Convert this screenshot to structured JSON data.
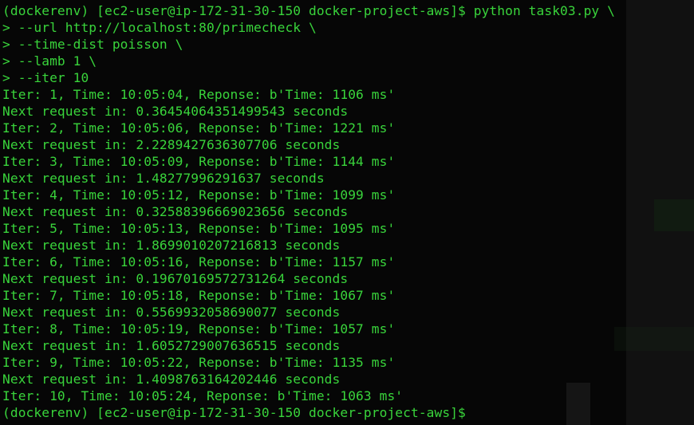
{
  "terminal": {
    "lines": [
      "(dockerenv) [ec2-user@ip-172-31-30-150 docker-project-aws]$ python task03.py \\",
      "> --url http://localhost:80/primecheck \\",
      "> --time-dist poisson \\",
      "> --lamb 1 \\",
      "> --iter 10",
      "Iter: 1, Time: 10:05:04, Reponse: b'Time: 1106 ms'",
      "Next request in: 0.36454064351499543 seconds",
      "Iter: 2, Time: 10:05:06, Reponse: b'Time: 1221 ms'",
      "Next request in: 2.2289427636307706 seconds",
      "Iter: 3, Time: 10:05:09, Reponse: b'Time: 1144 ms'",
      "Next request in: 1.48277996291637 seconds",
      "Iter: 4, Time: 10:05:12, Reponse: b'Time: 1099 ms'",
      "Next request in: 0.32588396669023656 seconds",
      "Iter: 5, Time: 10:05:13, Reponse: b'Time: 1095 ms'",
      "Next request in: 1.8699010207216813 seconds",
      "Iter: 6, Time: 10:05:16, Reponse: b'Time: 1157 ms'",
      "Next request in: 0.19670169572731264 seconds",
      "Iter: 7, Time: 10:05:18, Reponse: b'Time: 1067 ms'",
      "Next request in: 0.5569932058690077 seconds",
      "Iter: 8, Time: 10:05:19, Reponse: b'Time: 1057 ms'",
      "Next request in: 1.6052729007636515 seconds",
      "Iter: 9, Time: 10:05:22, Reponse: b'Time: 1135 ms'",
      "Next request in: 1.4098763164202446 seconds",
      "Iter: 10, Time: 10:05:24, Reponse: b'Time: 1063 ms'"
    ],
    "prompt": "(dockerenv) [ec2-user@ip-172-31-30-150 docker-project-aws]$",
    "colors": {
      "text": "#39d43b",
      "background": "#060606"
    }
  }
}
